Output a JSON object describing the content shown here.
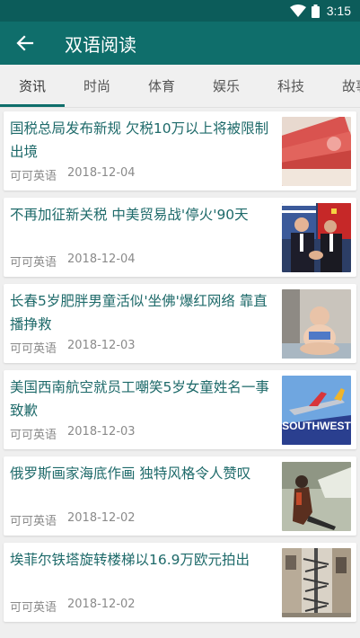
{
  "status_bar": {
    "time": "3:15"
  },
  "app_bar": {
    "title": "双语阅读"
  },
  "tabs": [
    {
      "label": "资讯",
      "active": true
    },
    {
      "label": "时尚"
    },
    {
      "label": "体育"
    },
    {
      "label": "娱乐"
    },
    {
      "label": "科技"
    },
    {
      "label": "故事"
    }
  ],
  "articles": [
    {
      "title": "国税总局发布新规 欠税10万以上将被限制出境",
      "source": "可可英语",
      "date": "2018-12-04",
      "thumb": "money"
    },
    {
      "title": "不再加征新关税 中美贸易战'停火'90天",
      "source": "可可英语",
      "date": "2018-12-04",
      "thumb": "handshake"
    },
    {
      "title": "长春5岁肥胖男童活似'坐佛'爆红网络 靠直播挣救",
      "source": "可可英语",
      "date": "2018-12-03",
      "thumb": "child"
    },
    {
      "title": "美国西南航空就员工嘲笑5岁女童姓名一事致歉",
      "source": "可可英语",
      "date": "2018-12-03",
      "thumb": "southwest",
      "thumb_text": "SOUTHWEST"
    },
    {
      "title": "俄罗斯画家海底作画 独特风格令人赞叹",
      "source": "可可英语",
      "date": "2018-12-02",
      "thumb": "diver"
    },
    {
      "title": "埃菲尔铁塔旋转楼梯以16.9万欧元拍出",
      "source": "可可英语",
      "date": "2018-12-02",
      "thumb": "stairs"
    }
  ],
  "colors": {
    "status_bar": "#0c5c5a",
    "app_bar": "#0f6e6b",
    "title_text": "#1e6a6a",
    "tab_indicator": "#0f6e6b"
  }
}
